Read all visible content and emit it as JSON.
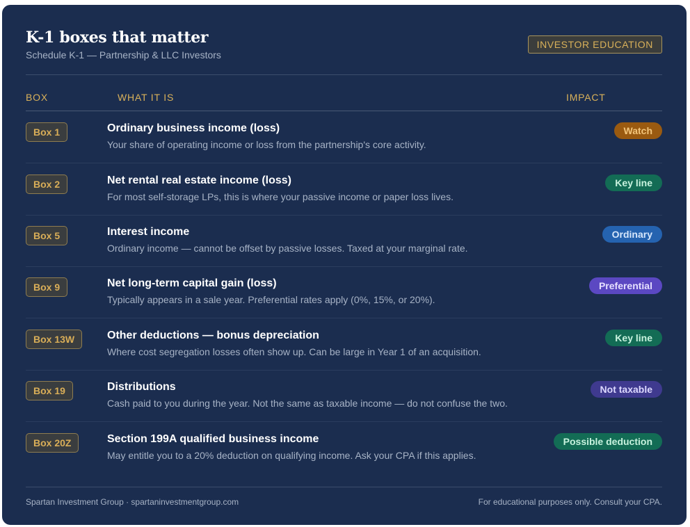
{
  "header": {
    "title": "K-1 boxes that matter",
    "subtitle": "Schedule K-1 — Partnership & LLC Investors",
    "badge": "INVESTOR EDUCATION"
  },
  "columns": {
    "box": "BOX",
    "what": "WHAT IT IS",
    "impact": "IMPACT"
  },
  "rows": [
    {
      "box": "Box 1",
      "title": "Ordinary business income (loss)",
      "desc": "Your share of operating income or loss from the partnership's core activity.",
      "impact": "Watch",
      "impact_bg": "#9a5a10",
      "impact_fg": "#f3c57a"
    },
    {
      "box": "Box 2",
      "title": "Net rental real estate income (loss)",
      "desc": "For most self-storage LPs, this is where your passive income or paper loss lives.",
      "impact": "Key line",
      "impact_bg": "#136c55",
      "impact_fg": "#c7f2de"
    },
    {
      "box": "Box 5",
      "title": "Interest income",
      "desc": "Ordinary income — cannot be offset by passive losses. Taxed at your marginal rate.",
      "impact": "Ordinary",
      "impact_bg": "#2563b0",
      "impact_fg": "#d6e6fb"
    },
    {
      "box": "Box 9",
      "title": "Net long-term capital gain (loss)",
      "desc": "Typically appears in a sale year. Preferential rates apply (0%, 15%, or 20%).",
      "impact": "Preferential",
      "impact_bg": "#5b48c2",
      "impact_fg": "#e6e0ff"
    },
    {
      "box": "Box 13W",
      "title": "Other deductions — bonus depreciation",
      "desc": "Where cost segregation losses often show up. Can be large in Year 1 of an acquisition.",
      "impact": "Key line",
      "impact_bg": "#136c55",
      "impact_fg": "#c7f2de"
    },
    {
      "box": "Box 19",
      "title": "Distributions",
      "desc": "Cash paid to you during the year. Not the same as taxable income — do not confuse the two.",
      "impact": "Not taxable",
      "impact_bg": "#3f3a8f",
      "impact_fg": "#dcd8ff"
    },
    {
      "box": "Box 20Z",
      "title": "Section 199A qualified business income",
      "desc": "May entitle you to a 20% deduction on qualifying income. Ask your CPA if this applies.",
      "impact": "Possible deduction",
      "impact_bg": "#136c55",
      "impact_fg": "#c7f2de"
    }
  ],
  "footer": {
    "left": "Spartan Investment Group  ·  spartaninvestmentgroup.com",
    "right": "For educational purposes only. Consult your CPA."
  }
}
